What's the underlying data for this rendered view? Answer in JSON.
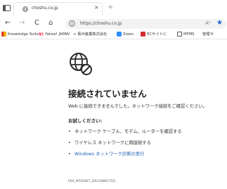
{
  "tab": {
    "title": "choshu.co.jp",
    "close": "×",
    "new_tab": "+"
  },
  "nav": {
    "back": "←",
    "forward": "→",
    "reload": "C",
    "home": "⌂"
  },
  "address": {
    "url": "https://choshu.co.jp",
    "reader_mode": "Aᴬ"
  },
  "bookmarks": [
    {
      "label": "Knowledge Suite",
      "color": "#e0442c"
    },
    {
      "label": "Yahoo! JAPAN",
      "color": "#ff0033"
    },
    {
      "label": "∞ 長州産業株式会社",
      "color": "#d81e1e"
    },
    {
      "label": "Zoom",
      "color": "#2d8cff"
    },
    {
      "label": "ECサイトに",
      "color": "#d32f2f"
    },
    {
      "label": "MFMS",
      "color": "#555555"
    },
    {
      "label": "管理サ",
      "color": "#777777"
    }
  ],
  "error": {
    "heading": "接続されていません",
    "description": "Web に接続できませんでした。ネットワーク接続をご確認ください。",
    "try_title": "お試しください:",
    "suggestions": [
      "ネットワーク ケーブル、モデム、ルーターを確認する",
      "ワイヤレス ネットワークに再接続する",
      "Windows ネットワーク診断の実行"
    ],
    "error_code": "ERR_INTERNET_DISCONNECTED"
  }
}
